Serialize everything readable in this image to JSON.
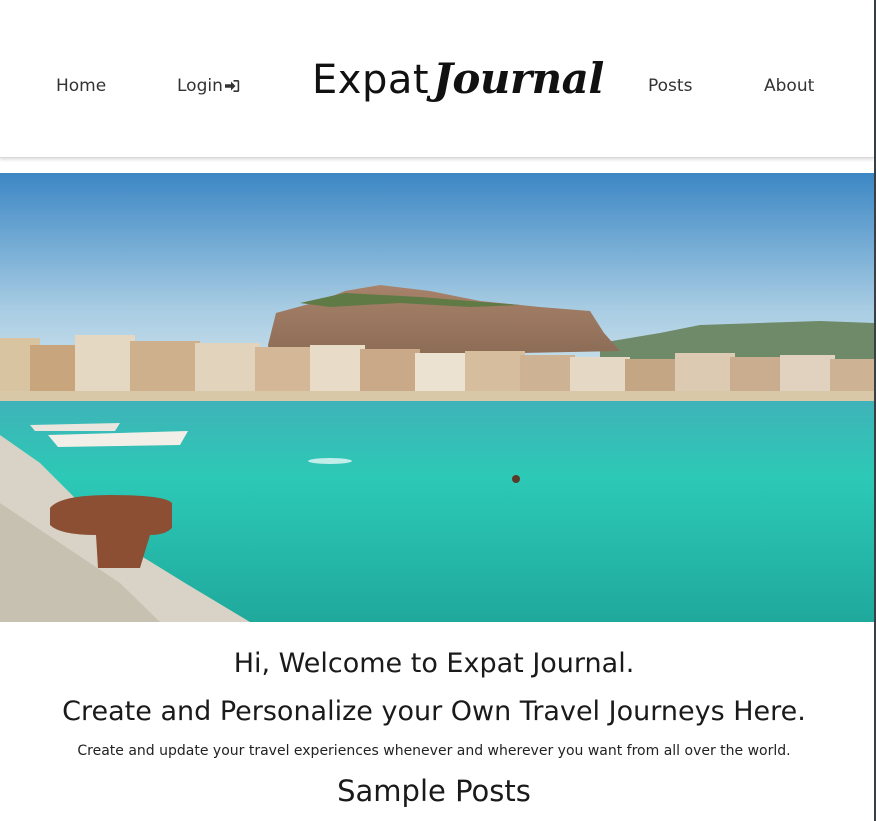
{
  "nav": {
    "home": "Home",
    "login": "Login",
    "logo_part1": "Expat",
    "logo_part2": "Journal",
    "posts": "Posts",
    "about": "About"
  },
  "hero": {
    "image_subject": "coastal-town-beach"
  },
  "welcome": {
    "heading": "Hi, Welcome to Expat Journal.",
    "tagline": "Create and Personalize your Own Travel Journeys Here.",
    "description": "Create and update your travel experiences whenever and wherever you want from all over the world.",
    "sample_heading": "Sample Posts"
  },
  "icons": {
    "login": "sign-in-icon"
  },
  "colors": {
    "text": "#1f1f1f",
    "nav_text": "#333333",
    "sea": "#2cc9b6"
  }
}
